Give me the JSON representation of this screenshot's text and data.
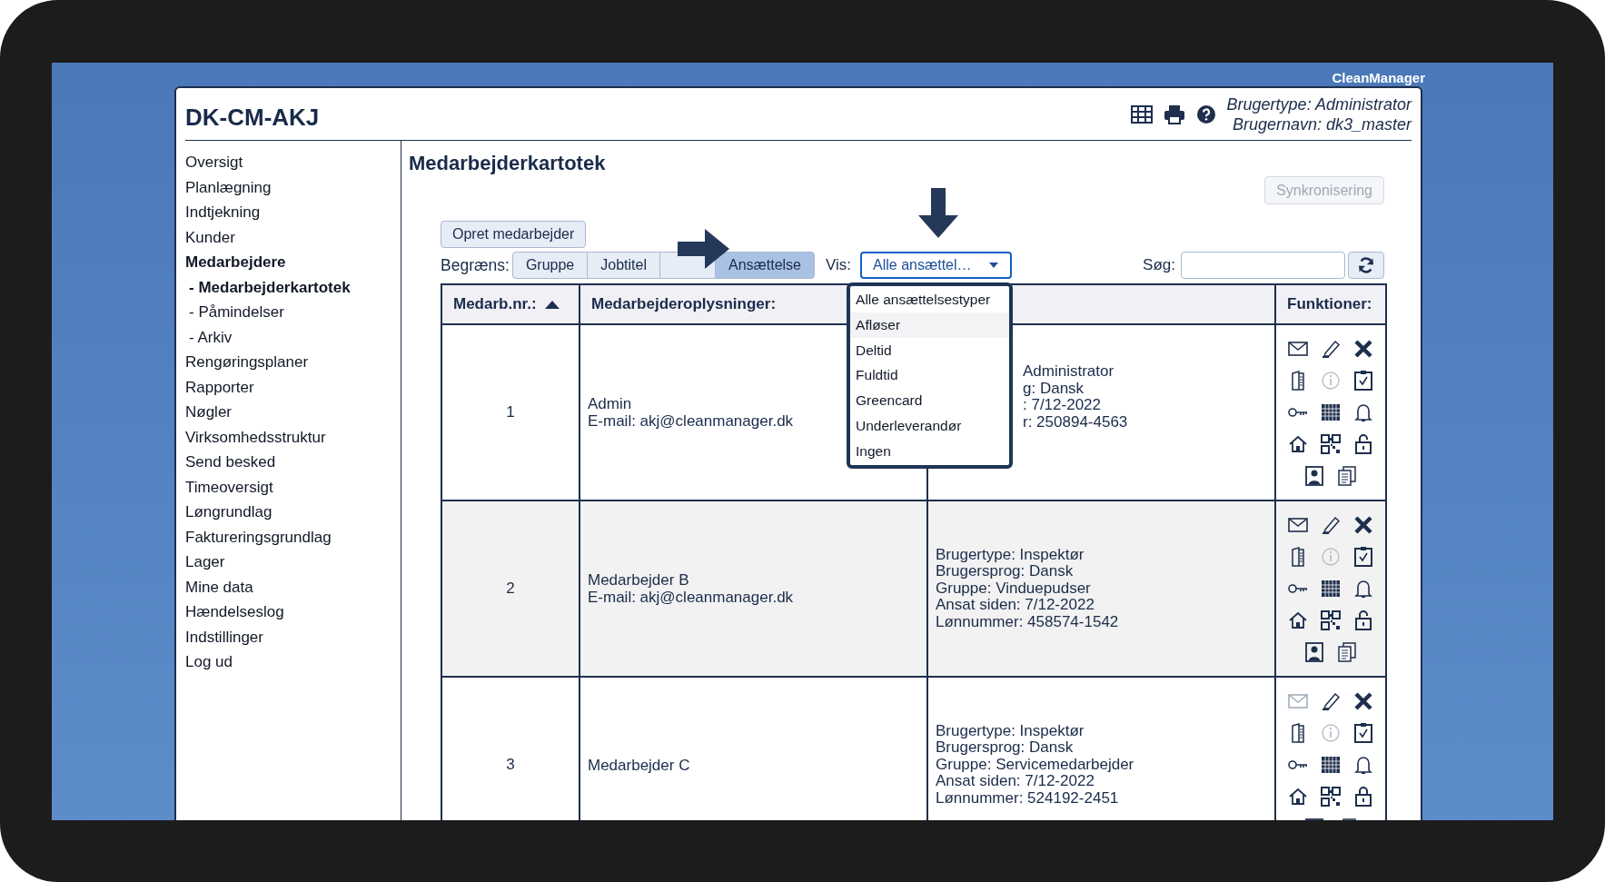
{
  "brand": "CleanManager",
  "window": {
    "title": "DK-CM-AKJ",
    "user_type": "Brugertype: Administrator",
    "user_name": "Brugernavn: dk3_master"
  },
  "sidebar": {
    "items": [
      {
        "label": "Oversigt",
        "selected": false
      },
      {
        "label": "Planlægning",
        "selected": false
      },
      {
        "label": "Indtjekning",
        "selected": false
      },
      {
        "label": "Kunder",
        "selected": false
      },
      {
        "label": "Medarbejdere",
        "selected": true,
        "children": [
          {
            "label": "- Medarbejderkartotek",
            "selected": true
          },
          {
            "label": "- Påmindelser",
            "selected": false
          },
          {
            "label": "- Arkiv",
            "selected": false
          }
        ]
      },
      {
        "label": "Rengøringsplaner",
        "selected": false
      },
      {
        "label": "Rapporter",
        "selected": false
      },
      {
        "label": "Nøgler",
        "selected": false
      },
      {
        "label": "Virksomhedsstruktur",
        "selected": false
      },
      {
        "label": "Send besked",
        "selected": false
      },
      {
        "label": "Timeoversigt",
        "selected": false
      },
      {
        "label": "Løngrundlag",
        "selected": false
      },
      {
        "label": "Faktureringsgrundlag",
        "selected": false
      },
      {
        "label": "Lager",
        "selected": false
      },
      {
        "label": "Mine data",
        "selected": false
      },
      {
        "label": "Hændelseslog",
        "selected": false
      },
      {
        "label": "Indstillinger",
        "selected": false
      },
      {
        "label": "Log ud",
        "selected": false
      }
    ]
  },
  "page": {
    "title": "Medarbejderkartotek",
    "sync_button": {
      "label": "Synkronisering",
      "disabled": true
    },
    "create_button": "Opret medarbejder"
  },
  "filter": {
    "label": "Begræns:",
    "buttons": [
      {
        "kind": "text",
        "label": "Gruppe",
        "selected": false
      },
      {
        "kind": "text",
        "label": "Jobtitel",
        "selected": false
      },
      {
        "kind": "covered",
        "selected": false
      },
      {
        "kind": "text",
        "label": "Ansættelse",
        "selected": true
      }
    ]
  },
  "show": {
    "label": "Vis:",
    "value": "Alle ansættel…",
    "expanded": true,
    "options": [
      {
        "label": "Alle ansættelsestyper",
        "hovered": false
      },
      {
        "label": "Afløser",
        "hovered": true
      },
      {
        "label": "Deltid",
        "hovered": false
      },
      {
        "label": "Fuldtid",
        "hovered": false
      },
      {
        "label": "Greencard",
        "hovered": false
      },
      {
        "label": "Underleverandør",
        "hovered": false
      },
      {
        "label": "Ingen",
        "hovered": false
      }
    ]
  },
  "search": {
    "label": "Søg:"
  },
  "table": {
    "columns": [
      {
        "label": "Medarb.nr.:",
        "sorted_ascending": true
      },
      {
        "label": "Medarbejderoplysninger:"
      },
      {
        "label": "Funktioner:"
      }
    ],
    "rows": [
      {
        "number": "1",
        "name_lines": [
          "Admin",
          "E-mail: akj@cleanmanager.dk"
        ],
        "info_lines": [
          "Administrator",
          "g: Dansk",
          ": 7/12-2022",
          "r: 250894-4563"
        ],
        "info_partly_covered": true,
        "mail_disabled": false,
        "info_disabled": true,
        "locked": false
      },
      {
        "number": "2",
        "name_lines": [
          "Medarbejder B",
          "E-mail: akj@cleanmanager.dk"
        ],
        "info_lines": [
          "Brugertype: Inspektør",
          "Brugersprog: Dansk",
          "Gruppe: Vinduepudser",
          "Ansat siden: 7/12-2022",
          "Lønnummer: 458574-1542"
        ],
        "info_partly_covered": false,
        "mail_disabled": false,
        "info_disabled": true,
        "locked": false
      },
      {
        "number": "3",
        "name_lines": [
          "Medarbejder C"
        ],
        "info_lines": [
          "Brugertype: Inspektør",
          "Brugersprog: Dansk",
          "Gruppe: Servicemedarbejder",
          "Ansat siden: 7/12-2022",
          "Lønnummer: 524192-2451"
        ],
        "info_partly_covered": false,
        "mail_disabled": true,
        "info_disabled": true,
        "locked": true
      }
    ]
  }
}
